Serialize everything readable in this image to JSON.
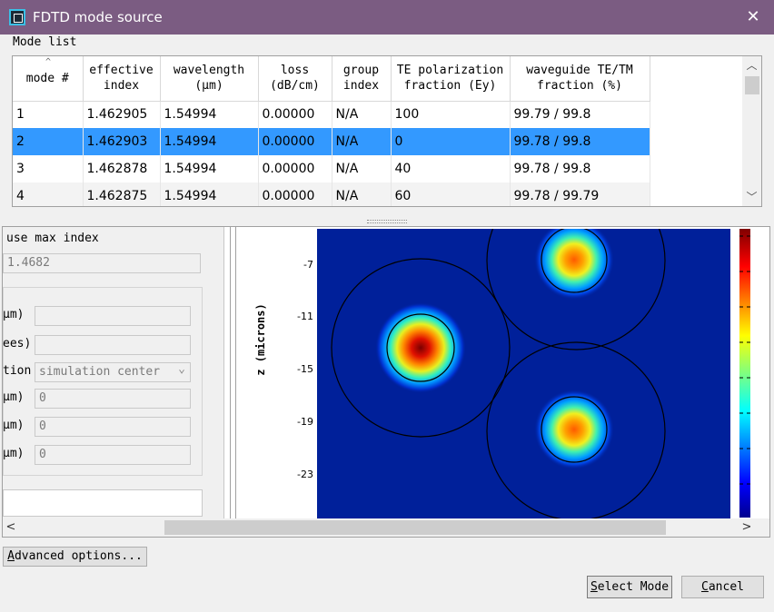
{
  "window": {
    "title": "FDTD mode source",
    "close_glyph": "✕"
  },
  "mode_list": {
    "group_label": "Mode list",
    "columns": [
      "mode #",
      "effective\nindex",
      "wavelength\n(μm)",
      "loss\n(dB/cm)",
      "group\nindex",
      "TE polarization\nfraction (Ey)",
      "waveguide TE/TM\nfraction (%)"
    ],
    "rows": [
      [
        "1",
        "1.462905",
        "1.54994",
        "0.00000",
        "N/A",
        "100",
        "99.79 / 99.8"
      ],
      [
        "2",
        "1.462903",
        "1.54994",
        "0.00000",
        "N/A",
        "0",
        "99.78 / 99.8"
      ],
      [
        "3",
        "1.462878",
        "1.54994",
        "0.00000",
        "N/A",
        "40",
        "99.78 / 99.8"
      ],
      [
        "4",
        "1.462875",
        "1.54994",
        "0.00000",
        "N/A",
        "60",
        "99.78 / 99.79"
      ]
    ],
    "selected_row": 2
  },
  "settings": {
    "use_max_index_label": "use max index",
    "index_value": "1.4682",
    "frag_um_1": "μm)",
    "frag_ees": "ees)",
    "frag_tion": "tion",
    "select_value": "simulation center",
    "frag_um_2": "μm)",
    "value_0_a": "0",
    "frag_um_3": "μm)",
    "value_0_b": "0",
    "frag_um_4": "μm)",
    "value_0_c": "0"
  },
  "plot": {
    "ylabel": "z (microns)",
    "yticks": [
      "-7",
      "-11",
      "-15",
      "-19",
      "-23"
    ]
  },
  "buttons": {
    "advanced_options": "Advanced options...",
    "select_mode": "Select Mode",
    "cancel": "Cancel"
  },
  "colors": {
    "titlebar": "#7b5c82",
    "selection": "#3399ff",
    "field_background": "#00209a"
  }
}
